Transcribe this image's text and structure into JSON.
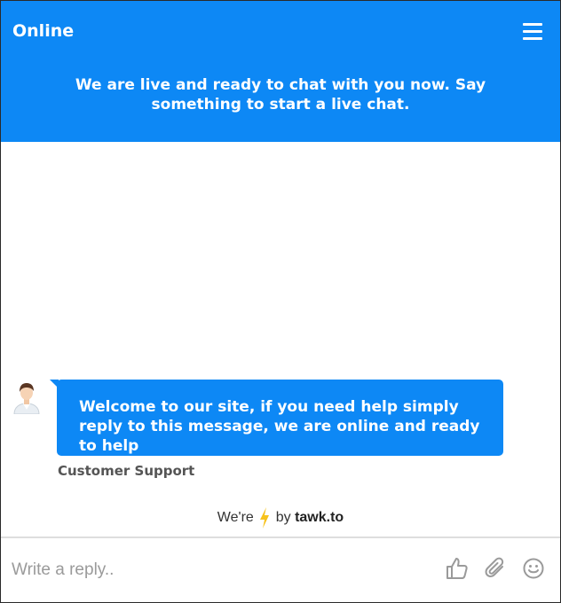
{
  "header": {
    "status": "Online",
    "message": "We are live and ready to chat with you now. Say something to start a live chat.",
    "menu_icon": "hamburger-menu-icon"
  },
  "conversation": {
    "messages": [
      {
        "sender": "Customer Support",
        "text": "Welcome to our site, if you need help simply reply to this message, we are online and ready to help",
        "avatar_icon": "agent-avatar-icon"
      }
    ]
  },
  "branding": {
    "prefix": "We're",
    "middle": "by",
    "brand": "tawk.to",
    "icon": "lightning-bolt-icon"
  },
  "footer": {
    "reply_placeholder": "Write a reply..",
    "icons": [
      "thumbs-up-icon",
      "paperclip-icon",
      "smiley-icon"
    ]
  },
  "colors": {
    "accent": "#0d88f5",
    "bolt": "#f7c21b",
    "icon_gray": "#9a9a9a"
  }
}
